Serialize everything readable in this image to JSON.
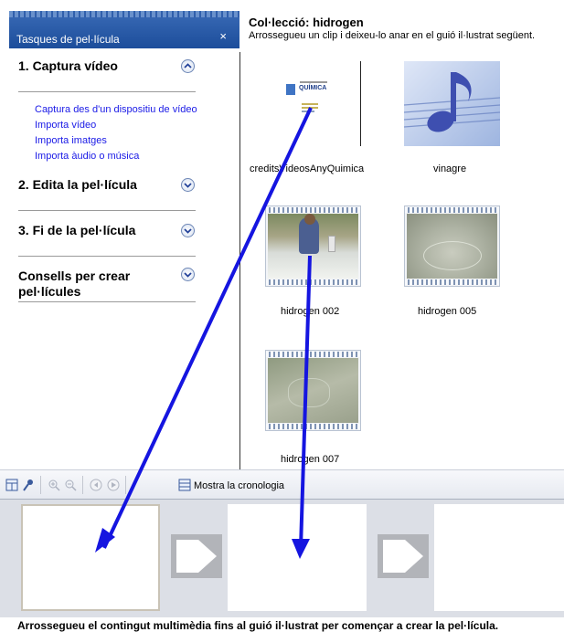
{
  "tasks_panel": {
    "title": "Tasques de pel·lícula",
    "close_label": "×",
    "sections": [
      {
        "label": "1. Captura vídeo",
        "expanded": true,
        "links": [
          "Captura des d'un dispositiu de vídeo",
          "Importa vídeo",
          "Importa imatges",
          "Importa àudio o música"
        ]
      },
      {
        "label": "2. Edita la pel·lícula",
        "expanded": false
      },
      {
        "label": "3. Fi de la pel·lícula",
        "expanded": false
      },
      {
        "label_line1": "Consells per crear",
        "label_line2": "pel·lícules",
        "expanded": false
      }
    ]
  },
  "collection": {
    "title": "Col·lecció: hidrogen",
    "subtitle": "Arrossegueu un clip i deixeu-lo anar en el guió il·lustrat següent.",
    "clips": [
      {
        "label": "creditsVideosAnyQuimica",
        "kind": "image"
      },
      {
        "label": "vinagre",
        "kind": "audio"
      },
      {
        "label": "hidrogen 002",
        "kind": "video"
      },
      {
        "label": "hidrogen 005",
        "kind": "video"
      },
      {
        "label": "hidrogen 007",
        "kind": "video"
      }
    ],
    "logo_text": "QUÍMICA"
  },
  "toolbar": {
    "timeline_label": "Mostra la cronologia",
    "icons": [
      "storyboard-icon",
      "narration-icon",
      "zoom-in-icon",
      "zoom-out-icon",
      "rewind-icon",
      "play-icon",
      "timeline-icon"
    ]
  },
  "storyboard": {
    "hint": "Arrossegueu el contingut multimèdia fins al guió il·lustrat per començar a crear la pel·lícula."
  },
  "colors": {
    "header_blue": "#1c4d9b",
    "link_blue": "#1a1ae6",
    "annotation_arrow": "#1515e0"
  }
}
